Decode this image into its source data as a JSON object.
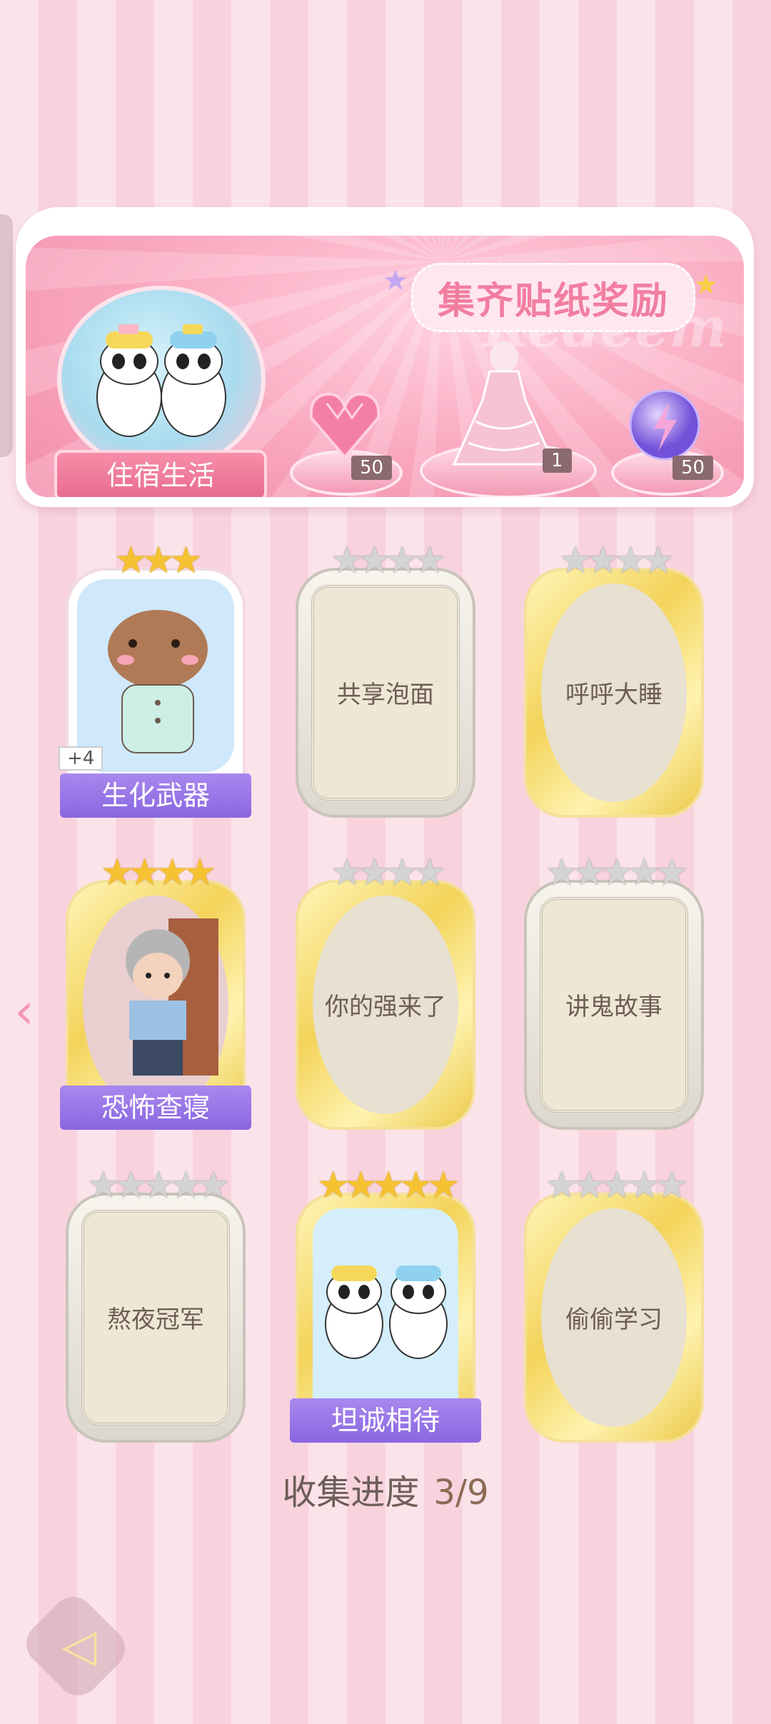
{
  "banner": {
    "title": "集齐贴纸奖励",
    "watermark": "Redeem",
    "collection_name": "住宿生活",
    "rewards": [
      {
        "icon": "pink-diamond-icon",
        "count": "50"
      },
      {
        "icon": "dress-outfit-icon",
        "count": "1"
      },
      {
        "icon": "energy-orb-icon",
        "count": "50"
      }
    ]
  },
  "cards": [
    {
      "name": "生化武器",
      "stars": 3,
      "max": 3,
      "unlocked": true,
      "extra": "+4"
    },
    {
      "name": "共享泡面",
      "stars": 0,
      "max": 4,
      "unlocked": false
    },
    {
      "name": "呼呼大睡",
      "stars": 0,
      "max": 4,
      "unlocked": false
    },
    {
      "name": "恐怖查寝",
      "stars": 4,
      "max": 4,
      "unlocked": true
    },
    {
      "name": "你的强来了",
      "stars": 0,
      "max": 4,
      "unlocked": false
    },
    {
      "name": "讲鬼故事",
      "stars": 0,
      "max": 5,
      "unlocked": false
    },
    {
      "name": "熬夜冠军",
      "stars": 0,
      "max": 5,
      "unlocked": false
    },
    {
      "name": "坦诚相待",
      "stars": 5,
      "max": 5,
      "unlocked": true
    },
    {
      "name": "偷偷学习",
      "stars": 0,
      "max": 5,
      "unlocked": false
    }
  ],
  "progress": {
    "label": "收集进度",
    "value": "3/9"
  }
}
